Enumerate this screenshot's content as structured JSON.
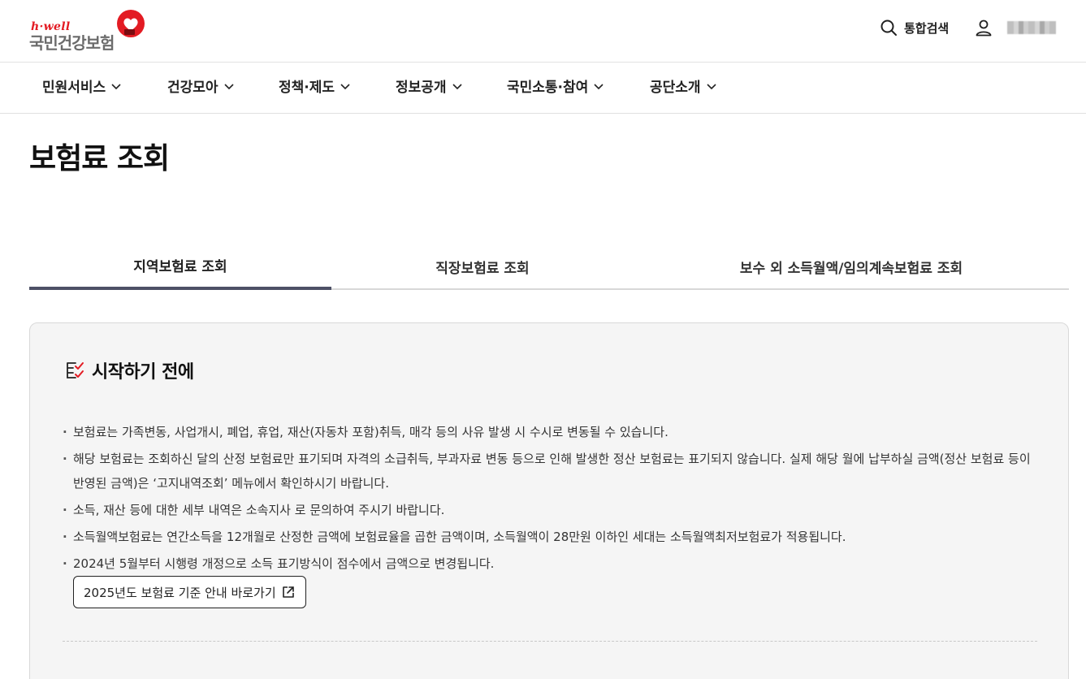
{
  "header": {
    "logo_small": "h·well",
    "logo_main": "국민건강보험",
    "search_label": "통합검색"
  },
  "nav": {
    "items": [
      {
        "label": "민원서비스"
      },
      {
        "label": "건강모아"
      },
      {
        "label": "정책·제도"
      },
      {
        "label": "정보공개"
      },
      {
        "label": "국민소통·참여"
      },
      {
        "label": "공단소개"
      }
    ]
  },
  "page": {
    "title": "보험료 조회"
  },
  "tabs": [
    {
      "label": "지역보험료 조회",
      "active": true
    },
    {
      "label": "직장보험료 조회",
      "active": false
    },
    {
      "label": "보수 외 소득월액/임의계속보험료 조회",
      "active": false
    }
  ],
  "info": {
    "title": "시작하기 전에",
    "items": [
      "보험료는 가족변동, 사업개시, 폐업, 휴업, 재산(자동차 포함)취득, 매각 등의 사유 발생 시 수시로 변동될 수 있습니다.",
      "해당 보험료는 조회하신 달의 산정 보험료만 표기되며 자격의 소급취득, 부과자료 변동 등으로 인해 발생한 정산 보험료는 표기되지 않습니다. 실제 해당 월에 납부하실 금액(정산 보험료 등이 반영된 금액)은 ‘고지내역조회’ 메뉴에서 확인하시기 바랍니다.",
      "소득, 재산 등에 대한 세부 내역은 소속지사 로 문의하여 주시기 바랍니다.",
      "소득월액보험료는 연간소득을 12개월로 산정한 금액에 보험료율을 곱한 금액이며, 소득월액이 28만원 이하인 세대는 소득월액최저보험료가 적용됩니다.",
      "2024년 5월부터 시행령 개정으로 소득 표기방식이 점수에서 금액으로 변경됩니다."
    ],
    "guide_button": "2025년도 보험료 기준 안내 바로가기"
  },
  "colors": {
    "brand_red": "#e31b23",
    "tab_active": "#4d5066"
  }
}
